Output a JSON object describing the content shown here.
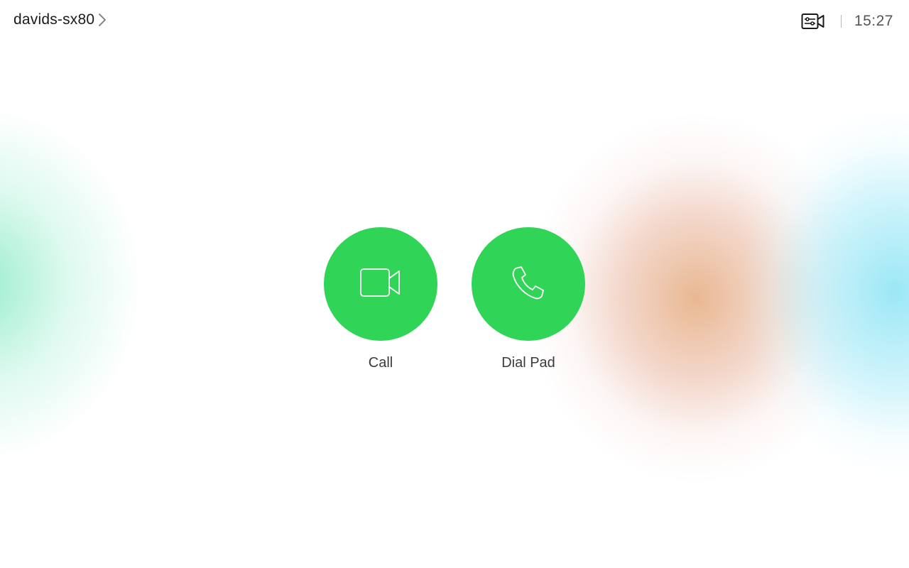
{
  "header": {
    "device_name": "davids-sx80",
    "time": "15:27"
  },
  "actions": [
    {
      "label": "Call",
      "icon": "video-camera-icon"
    },
    {
      "label": "Dial Pad",
      "icon": "phone-handset-icon"
    }
  ],
  "colors": {
    "action_green": "#30d557",
    "text_primary": "#1a1a1a",
    "text_secondary": "#555555"
  }
}
